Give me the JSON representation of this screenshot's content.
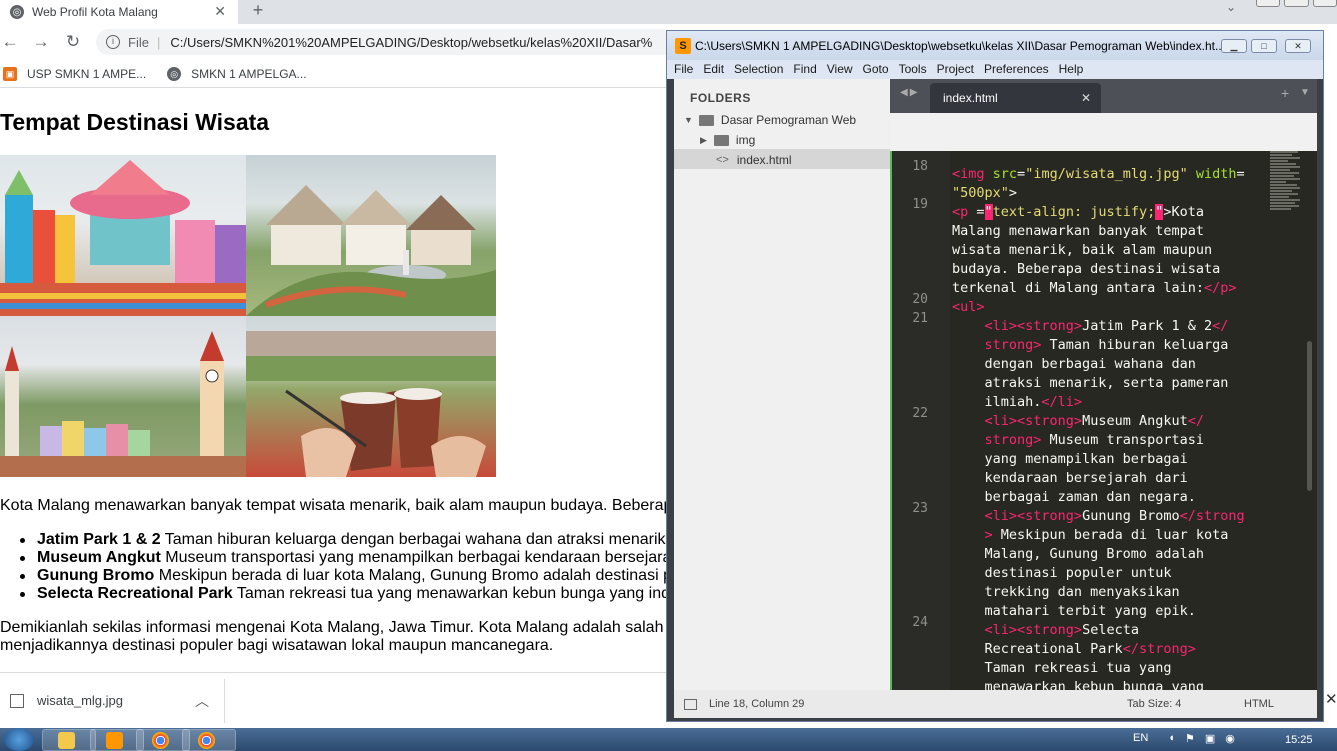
{
  "browser": {
    "tab_title": "Web Profil Kota Malang",
    "tab_close": "✕",
    "new_tab": "+",
    "address_label": "File",
    "address_url": "C:/Users/SMKN%201%20AMPELGADING/Desktop/websetku/kelas%20XII/Dasar%",
    "bookmarks": [
      "USP SMKN 1 AMPE...",
      "SMKN 1 AMPELGA..."
    ]
  },
  "page": {
    "heading": "Tempat Destinasi Wisata",
    "intro": "Kota Malang menawarkan banyak tempat wisata menarik, baik alam maupun budaya. Beberap",
    "items": [
      {
        "name": "Jatim Park 1 & 2",
        "desc": " Taman hiburan keluarga dengan berbagai wahana dan atraksi menarik"
      },
      {
        "name": "Museum Angkut",
        "desc": " Museum transportasi yang menampilkan berbagai kendaraan bersejara"
      },
      {
        "name": "Gunung Bromo",
        "desc": " Meskipun berada di luar kota Malang, Gunung Bromo adalah destinasi p"
      },
      {
        "name": "Selecta Recreational Park",
        "desc": " Taman rekreasi tua yang menawarkan kebun bunga yang ind"
      }
    ],
    "outro_1": "Demikianlah sekilas informasi mengenai Kota Malang, Jawa Timur. Kota Malang adalah salah s",
    "outro_2": "menjadikannya destinasi populer bagi wisatawan lokal maupun mancanegara."
  },
  "downloads": {
    "file": "wisata_mlg.jpg"
  },
  "sublime": {
    "title": "C:\\Users\\SMKN 1 AMPELGADING\\Desktop\\websetku\\kelas XII\\Dasar Pemograman Web\\index.ht...",
    "menu": [
      "File",
      "Edit",
      "Selection",
      "Find",
      "View",
      "Goto",
      "Tools",
      "Project",
      "Preferences",
      "Help"
    ],
    "folders_header": "FOLDERS",
    "root_folder": "Dasar Pemograman Web",
    "subfolder": "img",
    "file": "index.html",
    "tab": "index.html",
    "line_numbers": [
      "18",
      "19",
      "20",
      "21",
      "22",
      "23",
      "24"
    ],
    "status_position": "Line 18, Column 29",
    "status_tab": "Tab Size: 4",
    "status_syntax": "HTML"
  },
  "taskbar": {
    "lang": "EN",
    "clock": "15:25"
  }
}
